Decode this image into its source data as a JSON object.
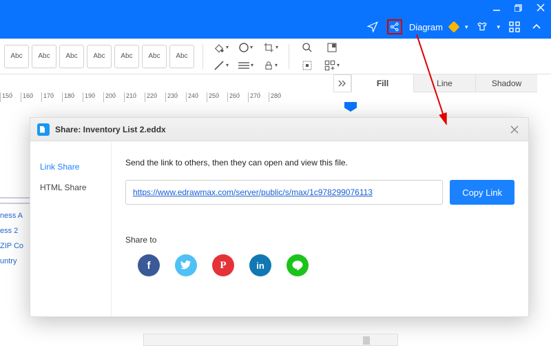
{
  "titlebar": {
    "app_label": "Diagram"
  },
  "toolbar": {
    "abc_label": "Abc"
  },
  "tabs": {
    "fill": "Fill",
    "line": "Line",
    "shadow": "Shadow"
  },
  "ruler": {
    "ticks": [
      "150",
      "160",
      "170",
      "180",
      "190",
      "200",
      "210",
      "220",
      "230",
      "240",
      "250",
      "260",
      "270",
      "280"
    ]
  },
  "leftcol": {
    "items": [
      "ness A",
      "ess 2",
      "ZIP Co",
      "untry"
    ]
  },
  "dialog": {
    "title": "Share: Inventory List 2.eddx",
    "side": {
      "link": "Link Share",
      "html": "HTML Share"
    },
    "desc": "Send the link to others, then they can open and view this file.",
    "url": "https://www.edrawmax.com/server/public/s/max/1c978299076113",
    "copy": "Copy Link",
    "shareto": "Share to"
  },
  "social": {
    "facebook_glyph": "f",
    "pinterest_glyph": "P",
    "linkedin_glyph": "in"
  }
}
